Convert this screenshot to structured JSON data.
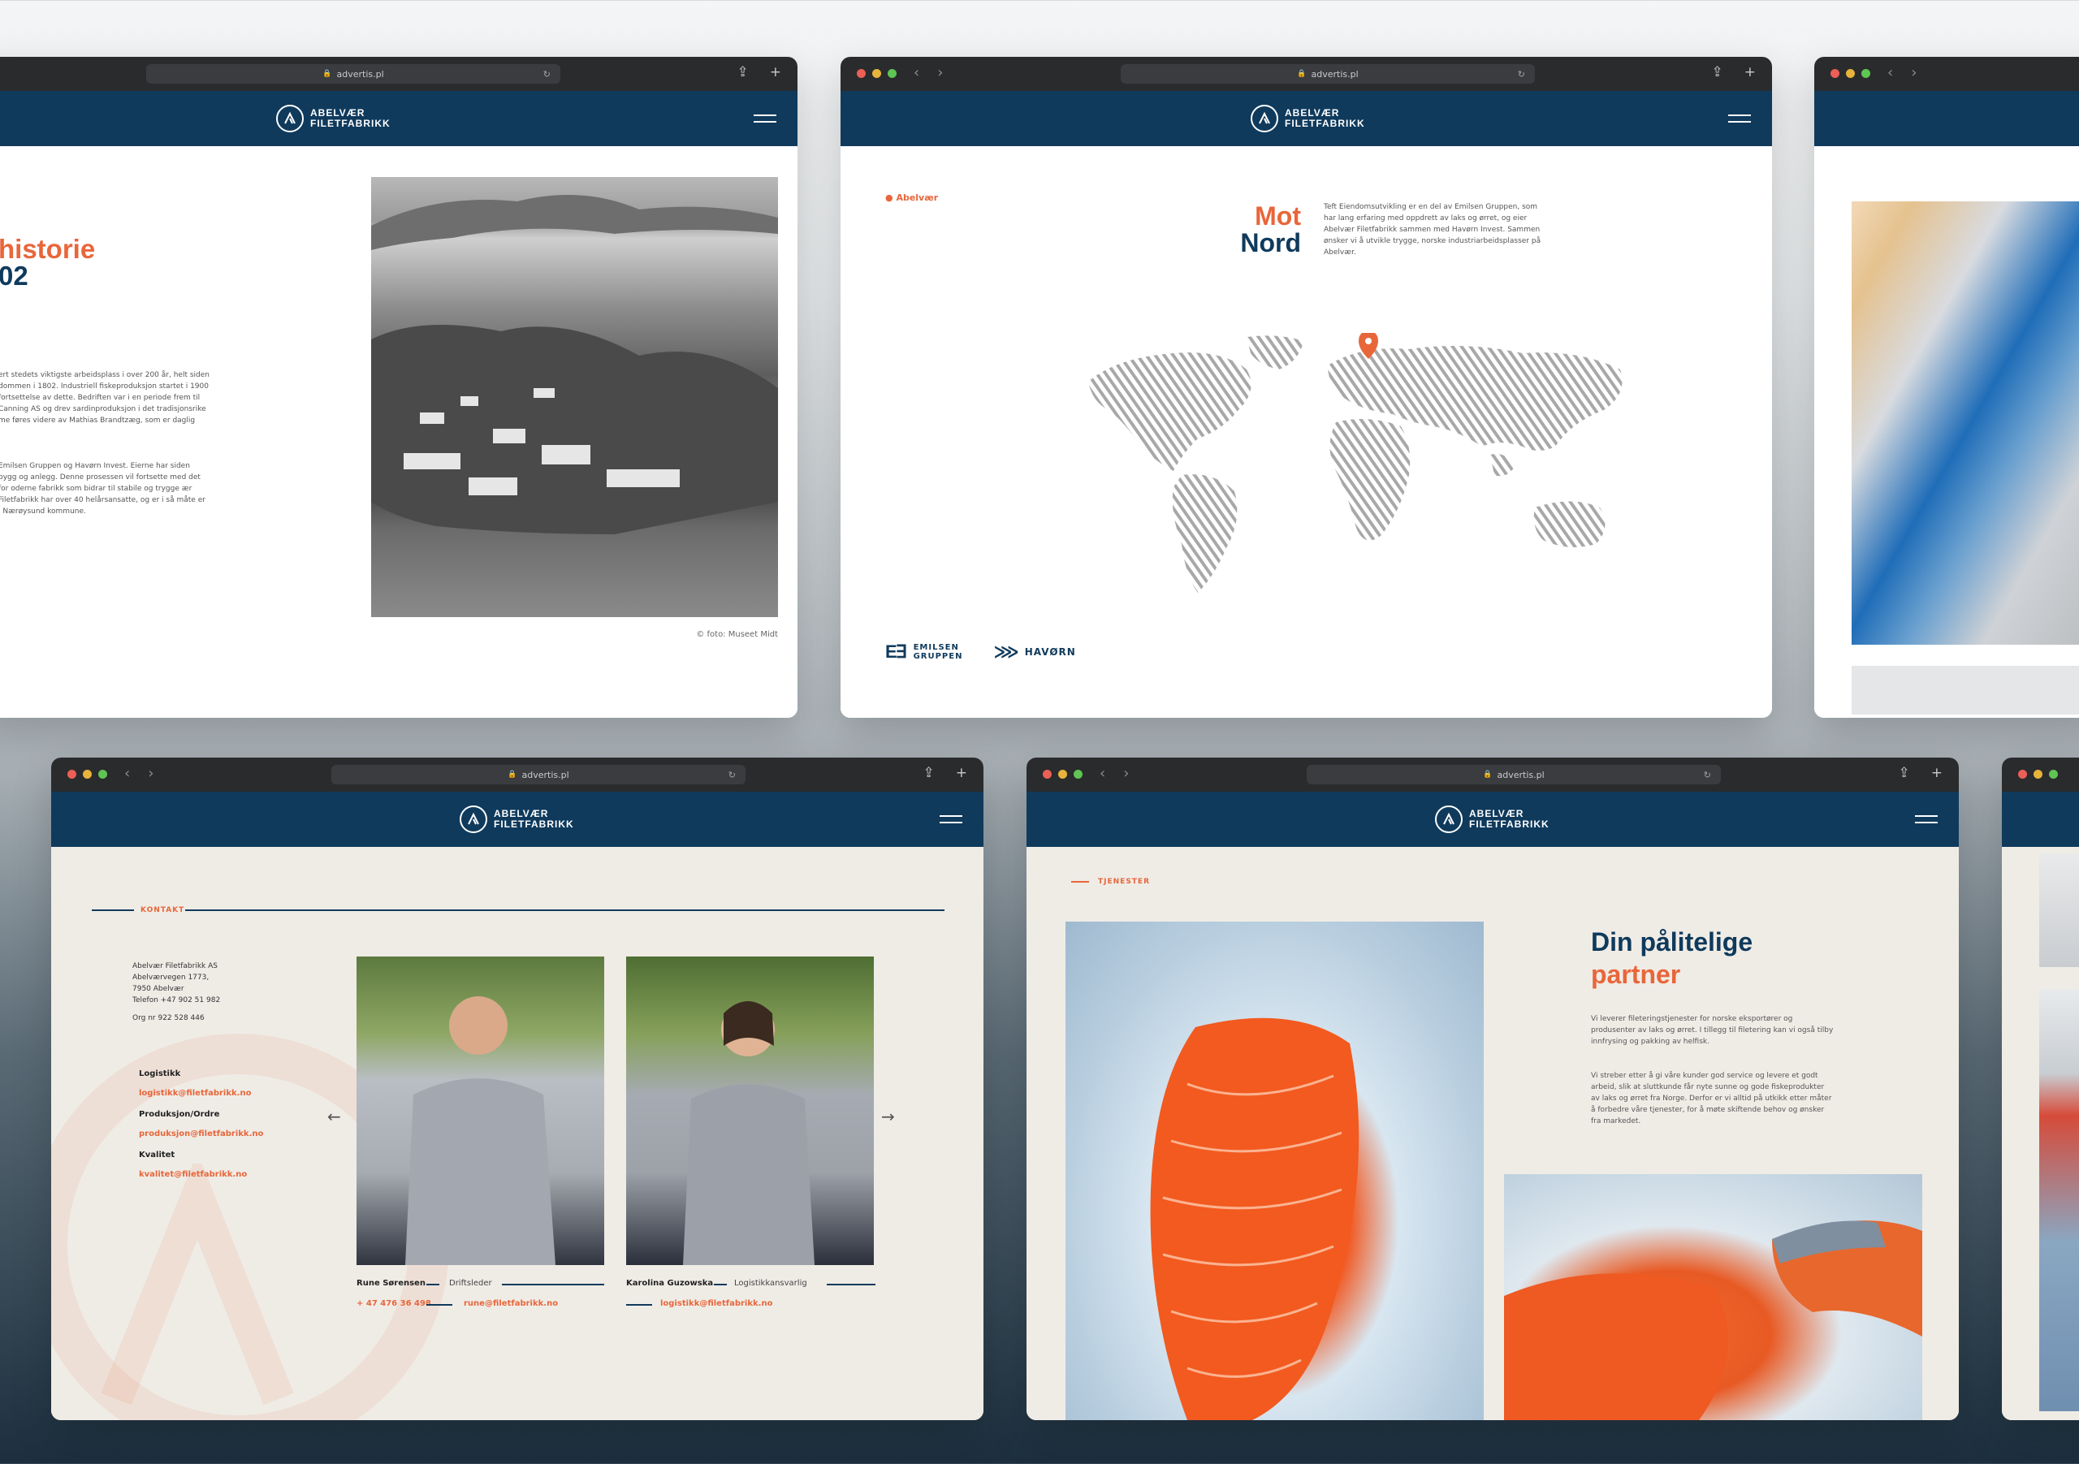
{
  "browser": {
    "url": "advertis.pl"
  },
  "brand": {
    "line1": "ABELVÆR",
    "line2": "FILETFABRIKK"
  },
  "history": {
    "title_line1": "historie",
    "title_line2": "02",
    "paragraph1": "ert stedets viktigste arbeidsplass i over 200 år, helt siden dommen i 1802. Industriell fiskeproduksjon startet i 1900 fortsettelse av dette. Bedriften var i en periode frem til Canning AS og drev sardinproduksjon i det tradisjonsrike me føres videre av Mathias Brandtzæg, som er daglig",
    "paragraph2": "Emilsen Gruppen og Havørn Invest. Eierne har siden bygg og anlegg. Denne prosessen vil fortsette med det for oderne fabrikk som bidrar til stabile og trygge ær Filetfabrikk har over 40 helårsansatte, og er i så måte er i Nærøysund kommune.",
    "photo_caption": "© foto: Museet Midt"
  },
  "motnord": {
    "crumb": "Abelvær",
    "title_line1": "Mot",
    "title_line2": "Nord",
    "paragraph": "Teft Eiendomsutvikling er en del av Emilsen Gruppen, som har lang erfaring med oppdrett av laks og ørret, og eier Abelvær Filetfabrikk sammen med Havørn Invest. Sammen ønsker vi å utvikle trygge, norske industriarbeidsplasser på Abelvær.",
    "logo1_line1": "EMILSEN",
    "logo1_line2": "GRUPPEN",
    "logo2": "HAVØRN"
  },
  "kontakt": {
    "section_label": "KONTAKT",
    "address": [
      "Abelvær Filetfabrikk AS",
      "Abelværvegen 1773,",
      "7950 Abelvær",
      "Telefon +47 902 51 982"
    ],
    "org": "Org nr 922 528 446",
    "departments": [
      {
        "name": "Logistikk",
        "email": "logistikk@filetfabrikk.no"
      },
      {
        "name": "Produksjon/Ordre",
        "email": "produksjon@filetfabrikk.no"
      },
      {
        "name": "Kvalitet",
        "email": "kvalitet@filetfabrikk.no"
      }
    ],
    "people": [
      {
        "name": "Rune Sørensen",
        "role": "Driftsleder",
        "phone": "+ 47 476 36 498",
        "email": "rune@filetfabrikk.no"
      },
      {
        "name": "Karolina Guzowska",
        "role": "Logistikkansvarlig",
        "email": "logistikk@filetfabrikk.no"
      }
    ]
  },
  "tjenester": {
    "section_label": "TJENESTER",
    "title_line1": "Din pålitelige",
    "title_line2": "partner",
    "paragraph1": "Vi leverer fileteringstjenester for norske eksportører og produsenter av laks og ørret. I tillegg til filetering kan vi også tilby innfrysing og pakking av helfisk.",
    "paragraph2": "Vi streber etter å gi våre kunder god service og levere et godt arbeid, slik at sluttkunde får nyte sunne og gode fiskeprodukter av laks og ørret fra Norge. Derfor er vi alltid på utkikk etter måter å forbedre våre tjenester, for å møte skiftende behov og ønsker fra markedet."
  },
  "colors": {
    "navy": "#0f3a5c",
    "orange": "#e8663a",
    "cream": "#efece6"
  }
}
